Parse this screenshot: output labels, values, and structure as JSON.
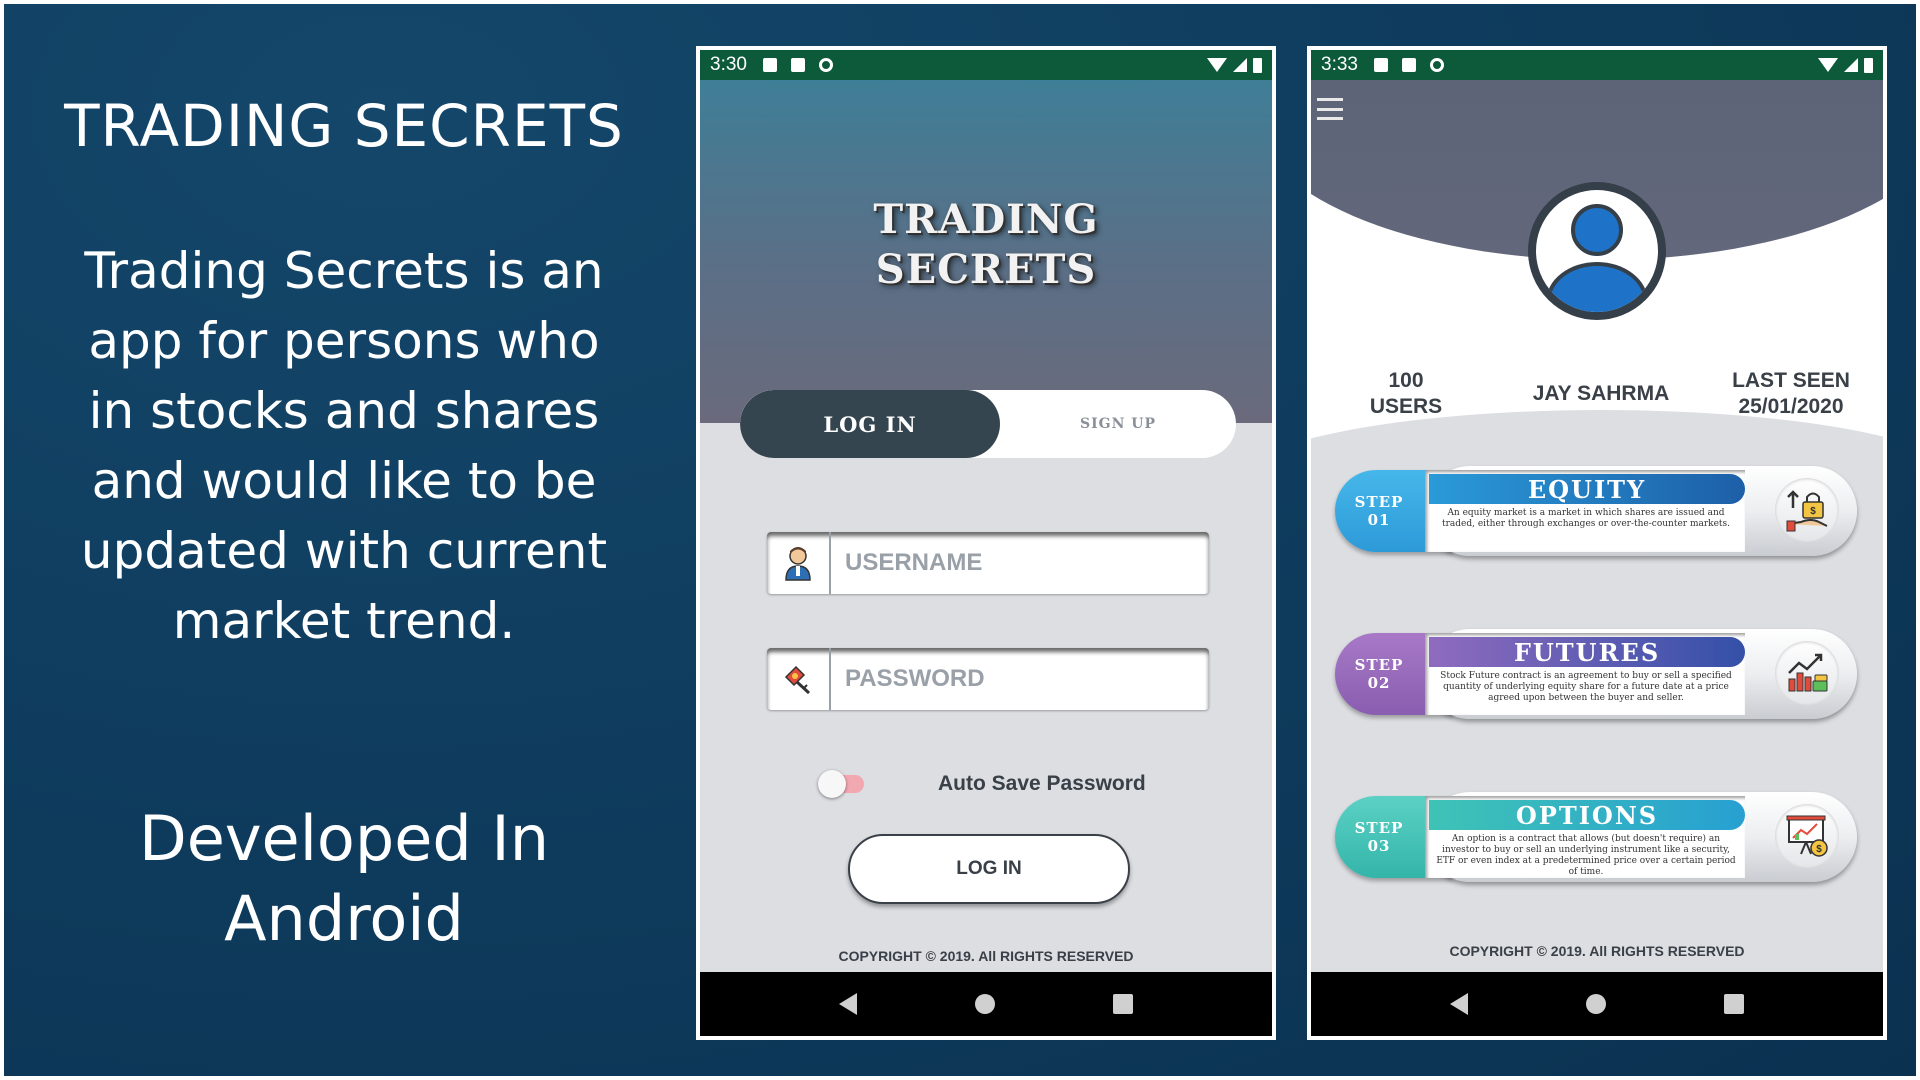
{
  "promo": {
    "title": "TRADING SECRETS",
    "description": "Trading Secrets is an app for persons who in stocks and shares and would like to be updated with current market trend.",
    "developed": "Developed In Android"
  },
  "login_screen": {
    "status_time": "3:30",
    "logo_line1": "TRADING",
    "logo_line2": "SECRETS",
    "tab_login": "LOG IN",
    "tab_signup": "SIGN UP",
    "username_placeholder": "USERNAME",
    "password_placeholder": "PASSWORD",
    "auto_save_label": "Auto Save Password",
    "auto_save_on": false,
    "login_button": "LOG IN",
    "copyright": "COPYRIGHT © 2019. All RIGHTS RESERVED"
  },
  "dashboard_screen": {
    "status_time": "3:33",
    "users_count": "100",
    "users_label": "USERS",
    "user_name": "JAY SAHRMA",
    "last_seen_label": "LAST SEEN",
    "last_seen_date": "25/01/2020",
    "steps": [
      {
        "step_label": "STEP",
        "step_number": "01",
        "title": "EQUITY",
        "text": "An equity market is a market in which shares are issued and traded, either through exchanges or over-the-counter markets.",
        "icon": "lock-money-hand-icon"
      },
      {
        "step_label": "STEP",
        "step_number": "02",
        "title": "FUTURES",
        "text": "Stock Future contract is an agreement to buy or sell a specified quantity of underlying equity share for a future date at a price agreed upon between the buyer and seller.",
        "icon": "growth-chart-icon"
      },
      {
        "step_label": "STEP",
        "step_number": "03",
        "title": "OPTIONS",
        "text": "An option is a contract that allows (but doesn't require) an investor to buy or sell an underlying instrument like a security, ETF or even index at a predetermined price over a certain period of time.",
        "icon": "presentation-chart-icon"
      }
    ],
    "copyright": "COPYRIGHT © 2019. All RIGHTS RESERVED"
  },
  "colors": {
    "background": "#0f3d5f",
    "statusbar": "#0d5a3b",
    "tab_active": "#35454f",
    "step1": "#2d9ad8",
    "step2": "#8a5db0",
    "step3": "#34b5aa"
  }
}
